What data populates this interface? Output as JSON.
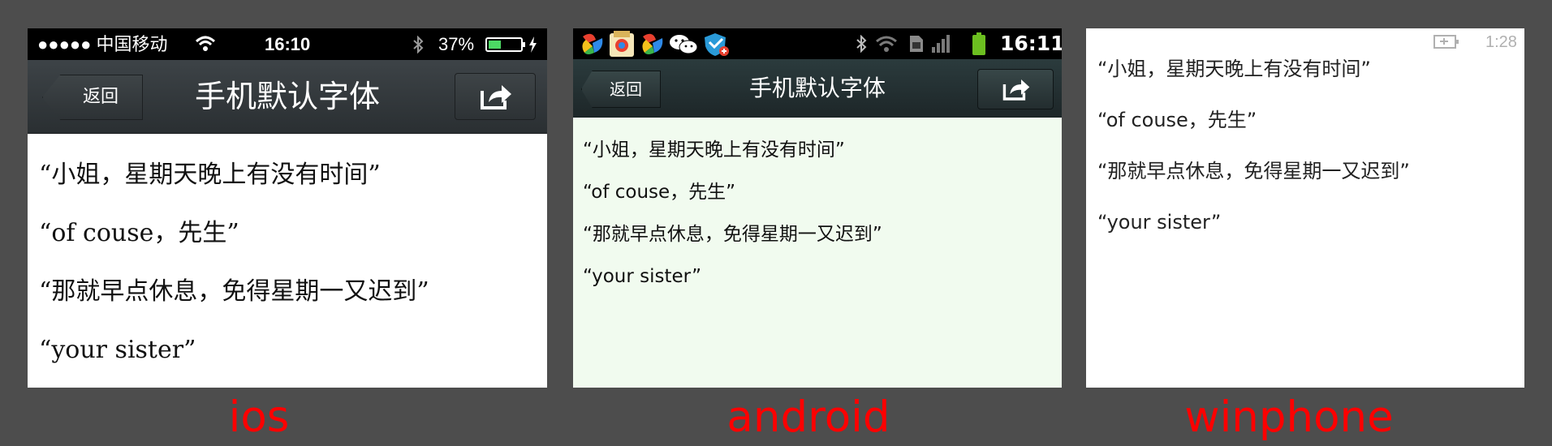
{
  "content_lines": [
    "“小姐，星期天晚上有没有时间”",
    "“of couse，先生”",
    "“那就早点休息，免得星期一又迟到”",
    "“your sister”"
  ],
  "ios": {
    "status": {
      "carrier": "●●●●● 中国移动",
      "time": "16:10",
      "battery": "37%"
    },
    "back_label": "返回",
    "title": "手机默认字体",
    "caption": "ios"
  },
  "android": {
    "status": {
      "time": "16:11"
    },
    "back_label": "返回",
    "title": "手机默认字体",
    "caption": "android"
  },
  "winphone": {
    "status": {
      "time": "1:28"
    },
    "caption": "winphone"
  },
  "colors": {
    "caption": "#ff0000",
    "background": "#4d4d4d",
    "android_content_bg": "#f1fbef"
  }
}
